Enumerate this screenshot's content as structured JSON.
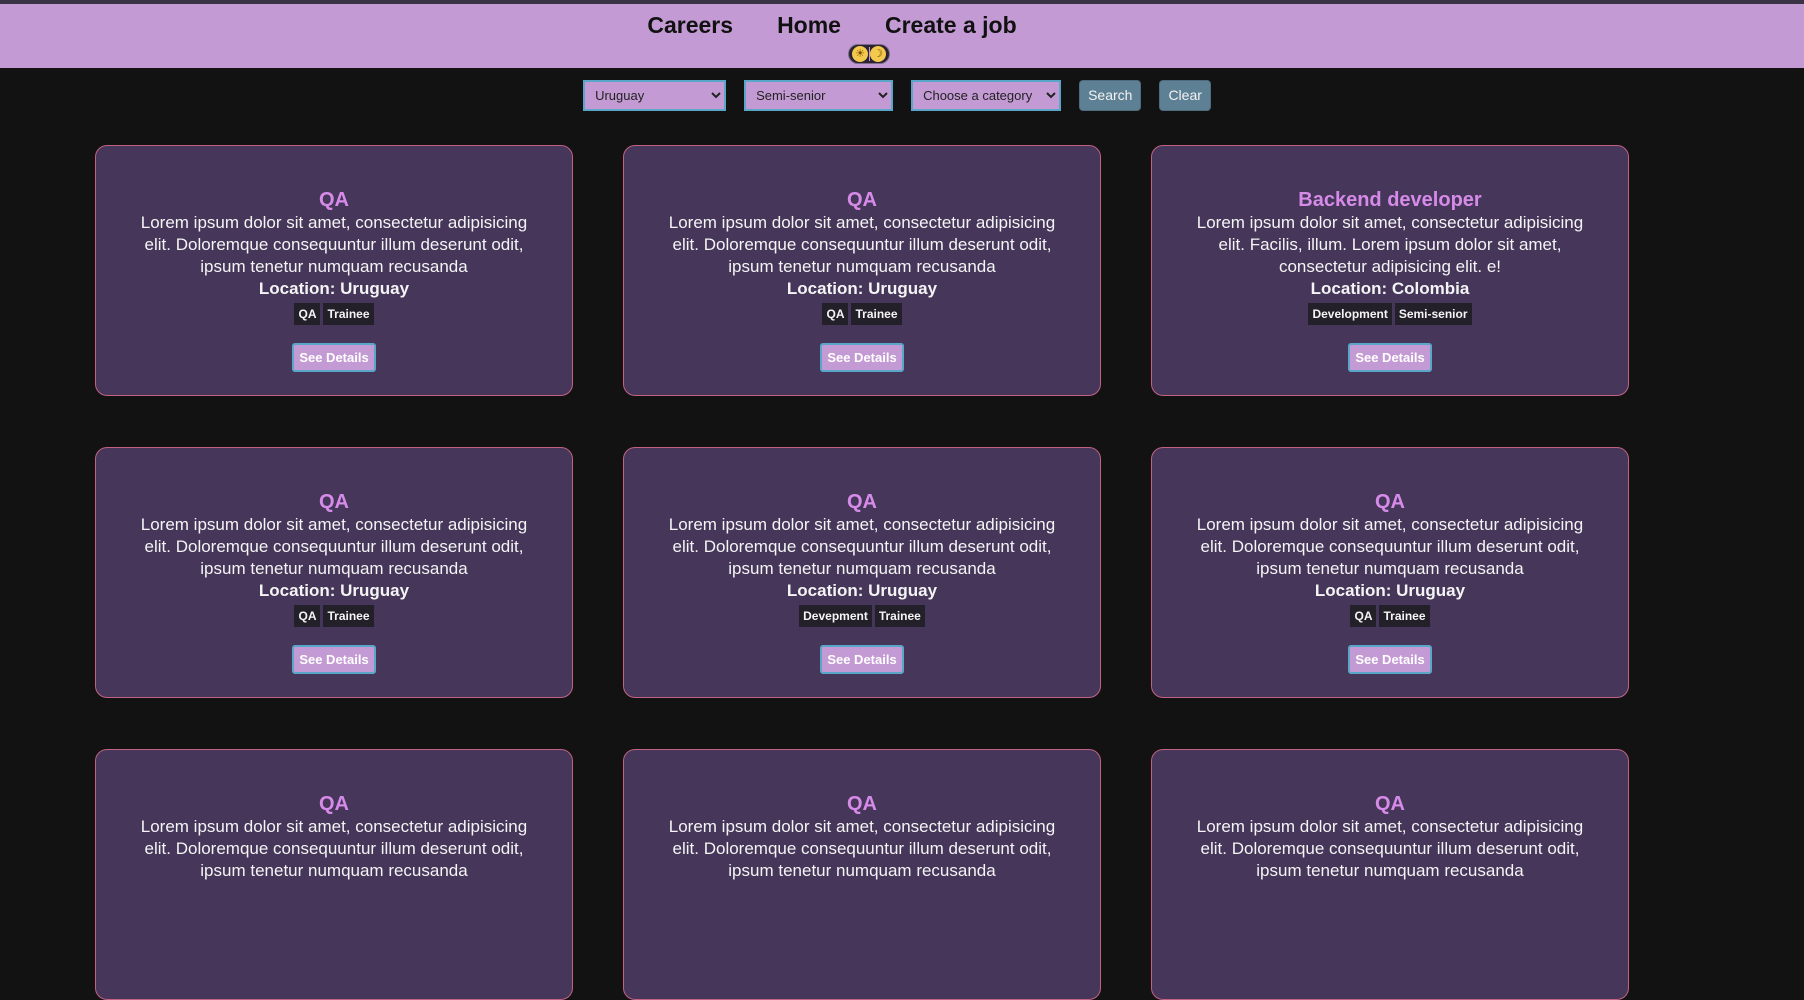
{
  "nav": {
    "links": [
      "Careers",
      "Home",
      "Create a job"
    ],
    "theme_toggle": {
      "light_icon": "☀",
      "dark_icon": "☽"
    }
  },
  "filters": {
    "country": "Uruguay",
    "level": "Semi-senior",
    "category": "Choose a category",
    "search_label": "Search",
    "clear_label": "Clear"
  },
  "colors": {
    "navbar": "#c39ad3",
    "background": "#121212",
    "card": "#45365a",
    "card_border": "#c26283",
    "title": "#d68be8"
  },
  "jobs": [
    {
      "title": "QA",
      "description": "Lorem ipsum dolor sit amet, consectetur adipisicing elit. Doloremque consequuntur illum deserunt odit, ipsum tenetur numquam recusanda",
      "location": "Location: Uruguay",
      "tags": [
        "QA",
        "Trainee"
      ],
      "button": "See Details"
    },
    {
      "title": "QA",
      "description": "Lorem ipsum dolor sit amet, consectetur adipisicing elit. Doloremque consequuntur illum deserunt odit, ipsum tenetur numquam recusanda",
      "location": "Location: Uruguay",
      "tags": [
        "QA",
        "Trainee"
      ],
      "button": "See Details"
    },
    {
      "title": "Backend developer",
      "description": "Lorem ipsum dolor sit amet, consectetur adipisicing elit. Facilis, illum. Lorem ipsum dolor sit amet, consectetur adipisicing elit. e!",
      "location": "Location: Colombia",
      "tags": [
        "Development",
        "Semi-senior"
      ],
      "button": "See Details"
    },
    {
      "title": "QA",
      "description": "Lorem ipsum dolor sit amet, consectetur adipisicing elit. Doloremque consequuntur illum deserunt odit, ipsum tenetur numquam recusanda",
      "location": "Location: Uruguay",
      "tags": [
        "QA",
        "Trainee"
      ],
      "button": "See Details"
    },
    {
      "title": "QA",
      "description": "Lorem ipsum dolor sit amet, consectetur adipisicing elit. Doloremque consequuntur illum deserunt odit, ipsum tenetur numquam recusanda",
      "location": "Location: Uruguay",
      "tags": [
        "Devepment",
        "Trainee"
      ],
      "button": "See Details"
    },
    {
      "title": "QA",
      "description": "Lorem ipsum dolor sit amet, consectetur adipisicing elit. Doloremque consequuntur illum deserunt odit, ipsum tenetur numquam recusanda",
      "location": "Location: Uruguay",
      "tags": [
        "QA",
        "Trainee"
      ],
      "button": "See Details"
    },
    {
      "title": "QA",
      "description": "Lorem ipsum dolor sit amet, consectetur adipisicing elit. Doloremque consequuntur illum deserunt odit, ipsum tenetur numquam recusanda",
      "location": "",
      "tags": [],
      "button": ""
    },
    {
      "title": "QA",
      "description": "Lorem ipsum dolor sit amet, consectetur adipisicing elit. Doloremque consequuntur illum deserunt odit, ipsum tenetur numquam recusanda",
      "location": "",
      "tags": [],
      "button": ""
    },
    {
      "title": "QA",
      "description": "Lorem ipsum dolor sit amet, consectetur adipisicing elit. Doloremque consequuntur illum deserunt odit, ipsum tenetur numquam recusanda",
      "location": "",
      "tags": [],
      "button": ""
    }
  ]
}
